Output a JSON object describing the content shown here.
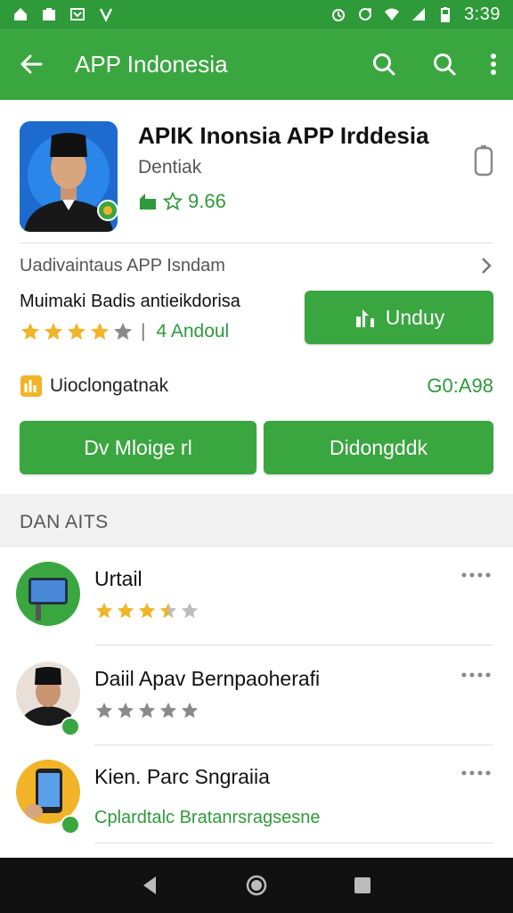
{
  "status_bar": {
    "time": "3:39"
  },
  "app_bar": {
    "title": "APP Indonesia",
    "icons": [
      "back-arrow-icon",
      "search-icon",
      "search-icon",
      "more-vert-icon"
    ]
  },
  "app": {
    "name": "APIK Inonsia APP Irddesia",
    "developer": "Dentiak",
    "rating": "9.66",
    "link_text": "Uadivaintaus APP Isndam",
    "subtitle": "Muimaki Badis antieikdorisa",
    "stars_text": "4 Andoul",
    "stars_filled": 4,
    "install_label": "Unduy",
    "size_label": "Uioclongatnak",
    "size_value": "G0:A98",
    "btn_left": "Dv Mloige rl",
    "btn_right": "Didongddk"
  },
  "section": {
    "title": "DAN AITS"
  },
  "list": [
    {
      "name": "Urtail",
      "stars_filled": 3.5,
      "type": "stars"
    },
    {
      "name": "Daiil Apav Bernpaoherafi",
      "stars_filled": 5,
      "type": "stars"
    },
    {
      "name": "Kien. Parc Sngraiia",
      "subtitle": "Cplardtalc Bratanrsragsesne",
      "type": "text"
    }
  ],
  "colors": {
    "accent": "#3aa640",
    "star": "#f1b428",
    "star_empty": "#bdbdbd"
  }
}
